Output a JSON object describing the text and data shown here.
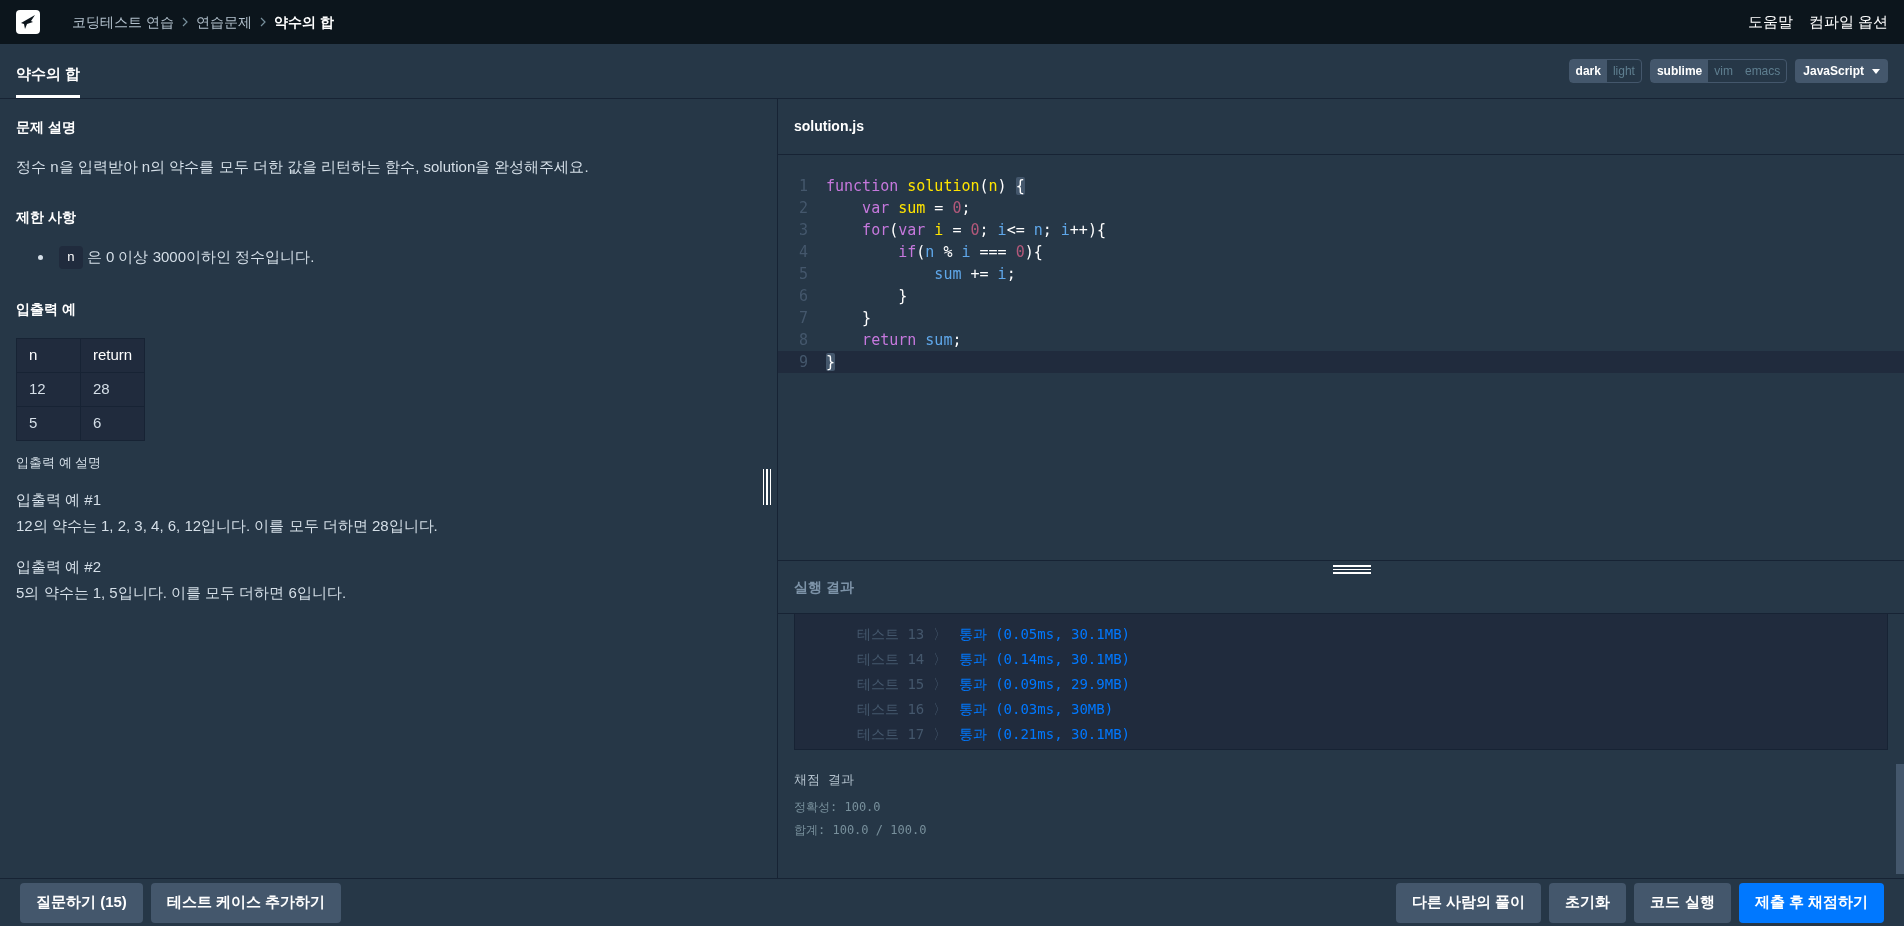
{
  "top_bar": {
    "breadcrumbs": [
      {
        "label": "코딩테스트 연습",
        "current": false
      },
      {
        "label": "연습문제",
        "current": false
      },
      {
        "label": "약수의 합",
        "current": true
      }
    ],
    "links": [
      "도움말",
      "컴파일 옵션"
    ]
  },
  "tab_bar": {
    "tabs": [
      {
        "label": "약수의 합",
        "selected": true
      }
    ],
    "themes": [
      {
        "label": "dark",
        "selected": true
      },
      {
        "label": "light",
        "selected": false
      }
    ],
    "keymaps": [
      {
        "label": "sublime",
        "selected": true
      },
      {
        "label": "vim",
        "selected": false
      },
      {
        "label": "emacs",
        "selected": false
      }
    ],
    "language": "JavaScript"
  },
  "problem": {
    "sections": [
      {
        "kind": "heading",
        "text": "문제 설명"
      },
      {
        "kind": "paragraph",
        "text": "정수 n을 입력받아 n의 약수를 모두 더한 값을 리턴하는 함수, solution을 완성해주세요."
      },
      {
        "kind": "heading",
        "text": "제한 사항"
      },
      {
        "kind": "bullet",
        "code": "n",
        "text": "은 0 이상 3000이하인 정수입니다."
      },
      {
        "kind": "heading",
        "text": "입출력 예"
      },
      {
        "kind": "table"
      },
      {
        "kind": "subheading",
        "text": "입출력 예 설명"
      },
      {
        "kind": "example_title",
        "text": "입출력 예 #1"
      },
      {
        "kind": "example_text",
        "text": "12의 약수는 1, 2, 3, 4, 6, 12입니다. 이를 모두 더하면 28입니다."
      },
      {
        "kind": "example_title",
        "text": "입출력 예 #2"
      },
      {
        "kind": "example_text",
        "text": "5의 약수는 1, 5입니다. 이를 모두 더하면 6입니다."
      }
    ],
    "table": {
      "columns": [
        "n",
        "return"
      ],
      "rows": [
        [
          "12",
          "28"
        ],
        [
          "5",
          "6"
        ]
      ]
    }
  },
  "editor": {
    "filename": "solution.js",
    "lines": [
      {
        "number": "1",
        "current": false,
        "tokens": [
          {
            "kind": "keyword",
            "text": "function"
          },
          {
            "kind": "def",
            "text": " solution"
          },
          {
            "kind": "plain",
            "text": "("
          },
          {
            "kind": "def",
            "text": "n"
          },
          {
            "kind": "plain",
            "text": ") "
          },
          {
            "kind": "bracket",
            "text": "{"
          }
        ]
      },
      {
        "number": "2",
        "current": false,
        "tokens": [
          {
            "kind": "keyword",
            "text": "    var"
          },
          {
            "kind": "def",
            "text": " sum"
          },
          {
            "kind": "plain",
            "text": " = "
          },
          {
            "kind": "number",
            "text": "0"
          },
          {
            "kind": "plain",
            "text": ";"
          }
        ]
      },
      {
        "number": "3",
        "current": false,
        "tokens": [
          {
            "kind": "keyword",
            "text": "    for"
          },
          {
            "kind": "plain",
            "text": "("
          },
          {
            "kind": "keyword",
            "text": "var"
          },
          {
            "kind": "def",
            "text": " i"
          },
          {
            "kind": "plain",
            "text": " = "
          },
          {
            "kind": "number",
            "text": "0"
          },
          {
            "kind": "plain",
            "text": "; "
          },
          {
            "kind": "variable",
            "text": "i"
          },
          {
            "kind": "plain",
            "text": "<= "
          },
          {
            "kind": "variable",
            "text": "n"
          },
          {
            "kind": "plain",
            "text": "; "
          },
          {
            "kind": "variable",
            "text": "i"
          },
          {
            "kind": "plain",
            "text": "++){"
          }
        ]
      },
      {
        "number": "4",
        "current": false,
        "tokens": [
          {
            "kind": "keyword",
            "text": "        if"
          },
          {
            "kind": "plain",
            "text": "("
          },
          {
            "kind": "variable",
            "text": "n"
          },
          {
            "kind": "plain",
            "text": " % "
          },
          {
            "kind": "variable",
            "text": "i"
          },
          {
            "kind": "plain",
            "text": " === "
          },
          {
            "kind": "number",
            "text": "0"
          },
          {
            "kind": "plain",
            "text": "){"
          }
        ]
      },
      {
        "number": "5",
        "current": false,
        "tokens": [
          {
            "kind": "variable",
            "text": "            sum"
          },
          {
            "kind": "plain",
            "text": " += "
          },
          {
            "kind": "variable",
            "text": "i"
          },
          {
            "kind": "plain",
            "text": ";"
          }
        ]
      },
      {
        "number": "6",
        "current": false,
        "tokens": [
          {
            "kind": "plain",
            "text": "        }"
          }
        ]
      },
      {
        "number": "7",
        "current": false,
        "tokens": [
          {
            "kind": "plain",
            "text": "    }"
          }
        ]
      },
      {
        "number": "8",
        "current": false,
        "tokens": [
          {
            "kind": "keyword",
            "text": "    return"
          },
          {
            "kind": "variable",
            "text": " sum"
          },
          {
            "kind": "plain",
            "text": ";"
          }
        ]
      },
      {
        "number": "9",
        "current": true,
        "tokens": [
          {
            "kind": "bracket",
            "text": "}"
          }
        ]
      }
    ]
  },
  "results": {
    "title": "실행 결과",
    "tests": [
      {
        "label": "테스트 13 〉",
        "result": "통과 (0.05ms, 30.1MB)"
      },
      {
        "label": "테스트 14 〉",
        "result": "통과 (0.14ms, 30.1MB)"
      },
      {
        "label": "테스트 15 〉",
        "result": "통과 (0.09ms, 29.9MB)"
      },
      {
        "label": "테스트 16 〉",
        "result": "통과 (0.03ms, 30MB)"
      },
      {
        "label": "테스트 17 〉",
        "result": "통과 (0.21ms, 30.1MB)"
      }
    ],
    "grading_title": "채점 결과",
    "grading_lines": [
      "정확성: 100.0",
      "합계: 100.0 / 100.0"
    ]
  },
  "bottom_bar": {
    "left_buttons": [
      "질문하기 (15)",
      "테스트 케이스 추가하기"
    ],
    "right_buttons": [
      {
        "label": "다른 사람의 풀이",
        "kind": "secondary"
      },
      {
        "label": "초기화",
        "kind": "secondary"
      },
      {
        "label": "코드 실행",
        "kind": "secondary"
      },
      {
        "label": "제출 후 채점하기",
        "kind": "primary"
      }
    ]
  }
}
